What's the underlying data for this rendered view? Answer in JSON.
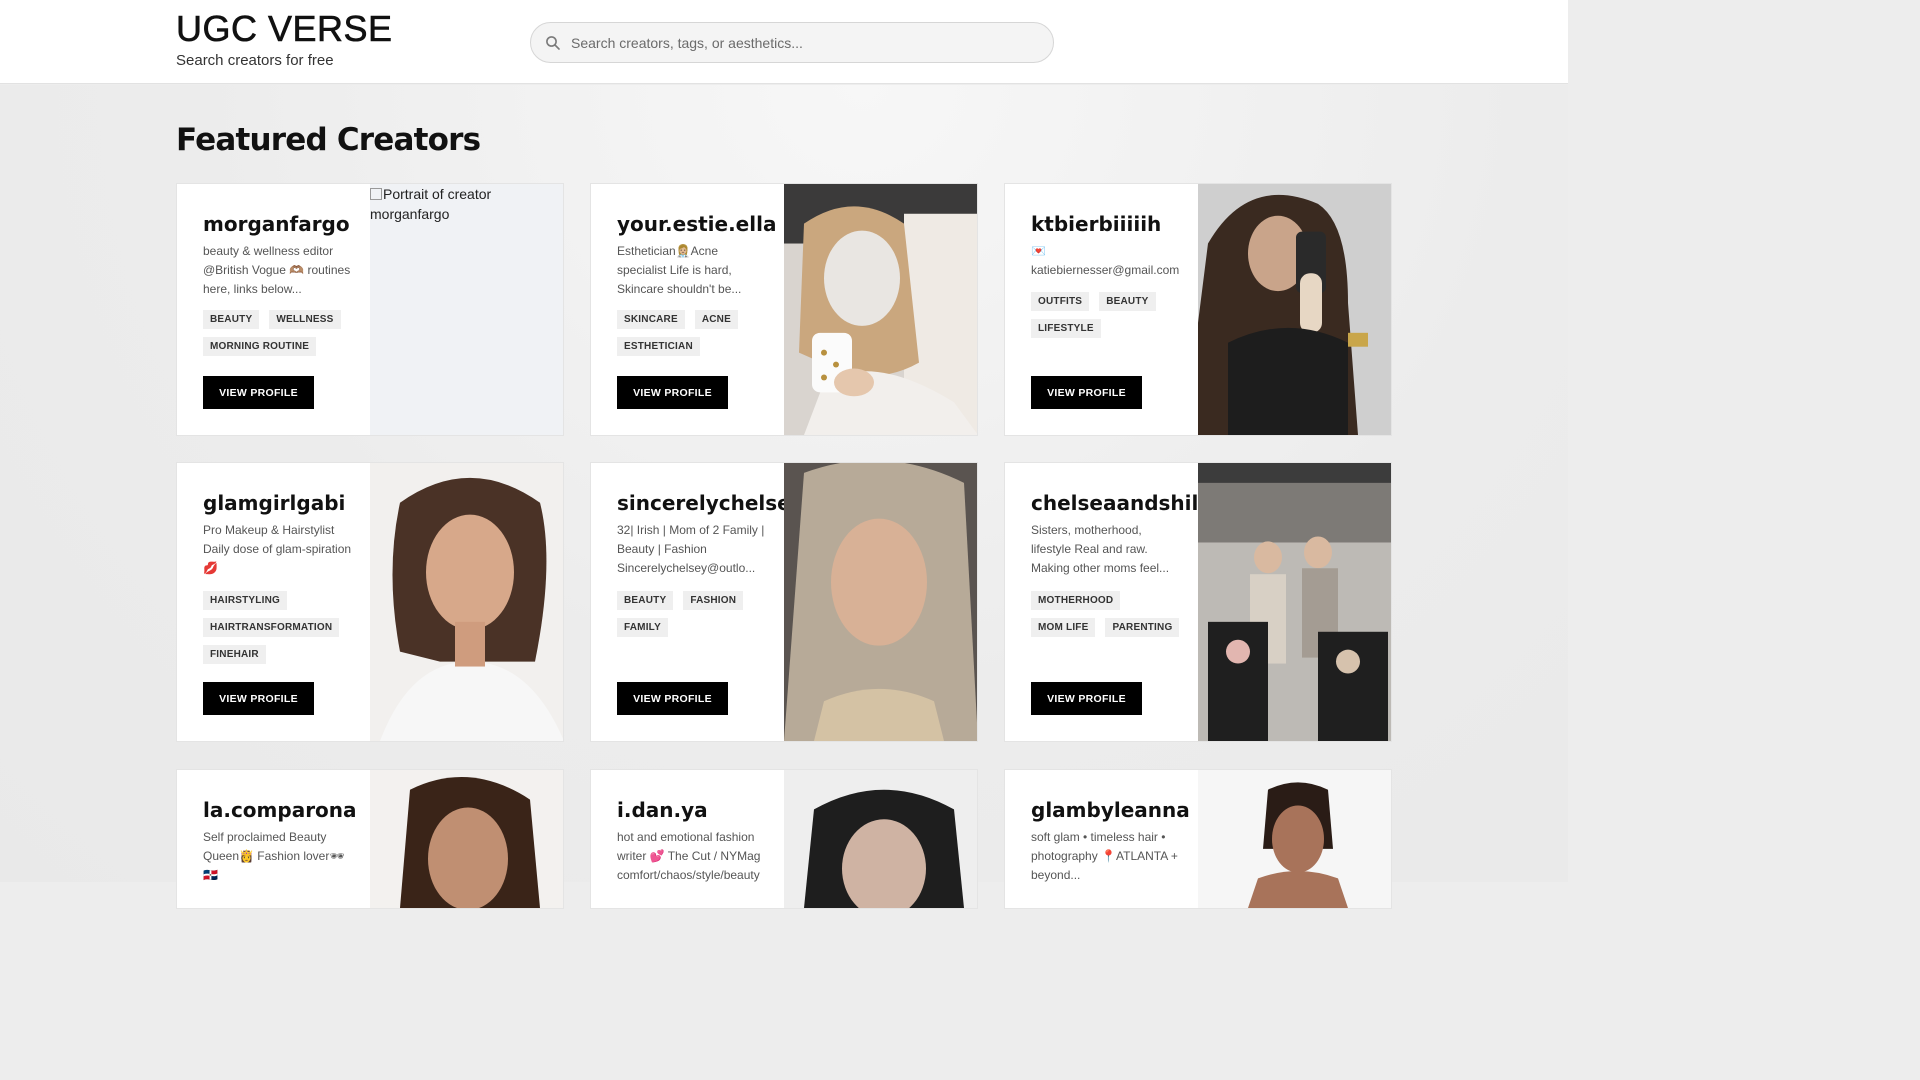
{
  "header": {
    "brand_title": "UGC VERSE",
    "brand_tagline": "Search creators for free",
    "search_placeholder": "Search creators, tags, or aesthetics..."
  },
  "main": {
    "section_title": "Featured Creators",
    "view_label": "VIEW PROFILE",
    "creators": [
      {
        "handle": "morganfargo",
        "bio": "beauty & wellness editor @British Vogue 🫶🏽 routines here, links below...",
        "tags": [
          "BEAUTY",
          "WELLNESS",
          "MORNING ROUTINE"
        ],
        "photo_alt": "Portrait of creator morganfargo",
        "photo_broken": true
      },
      {
        "handle": "your.estie.ella",
        "bio": "Esthetician👩🏼‍⚕️Acne specialist Life is hard, Skincare shouldn't be...",
        "tags": [
          "SKINCARE",
          "ACNE",
          "ESTHETICIAN"
        ],
        "photo_alt": "Portrait of creator your.estie.ella",
        "photo_broken": false
      },
      {
        "handle": "ktbierbiiiiih",
        "bio": "💌 katiebiernesser@gmail.com",
        "tags": [
          "OUTFITS",
          "BEAUTY",
          "LIFESTYLE"
        ],
        "photo_alt": "Portrait of creator ktbierbiiiiih",
        "photo_broken": false
      },
      {
        "handle": "glamgirlgabi",
        "bio": "Pro Makeup & Hairstylist Daily dose of glam-spiration💋",
        "tags": [
          "HAIRSTYLING",
          "HAIRTRANSFORMATION",
          "FINEHAIR"
        ],
        "photo_alt": "Portrait of creator glamgirlgabi",
        "photo_broken": false
      },
      {
        "handle": "sincerelychelsey",
        "bio": "32| Irish | Mom of 2 Family | Beauty | Fashion Sincerelychelsey@outlo...",
        "tags": [
          "BEAUTY",
          "FASHION",
          "FAMILY"
        ],
        "photo_alt": "Portrait of creator sincerelychelsey",
        "photo_broken": false
      },
      {
        "handle": "chelseaandshiloh",
        "bio": "Sisters, motherhood, lifestyle Real and raw. Making other moms feel...",
        "tags": [
          "MOTHERHOOD",
          "MOM LIFE",
          "PARENTING"
        ],
        "photo_alt": "Portrait of creator chelseaandshiloh",
        "photo_broken": false
      },
      {
        "handle": "la.comparona",
        "bio": "Self proclaimed Beauty Queen👸 Fashion lover🕶 🇩🇴",
        "tags": [],
        "photo_alt": "Portrait of creator la.comparona",
        "photo_broken": false
      },
      {
        "handle": "i.dan.ya",
        "bio": "hot and emotional fashion writer 💕 The Cut / NYMag comfort/chaos/style/beauty",
        "tags": [],
        "photo_alt": "Portrait of creator i.dan.ya",
        "photo_broken": false
      },
      {
        "handle": "glambyleanna",
        "bio": "soft glam • timeless hair • photography 📍ATLANTA + beyond...",
        "tags": [],
        "photo_alt": "Portrait of creator glambyleanna",
        "photo_broken": false
      }
    ]
  },
  "colors": {
    "accent_button": "#000000",
    "page_bg": "#ededed",
    "tag_bg": "#efefef"
  },
  "icons": [
    "search-icon"
  ]
}
